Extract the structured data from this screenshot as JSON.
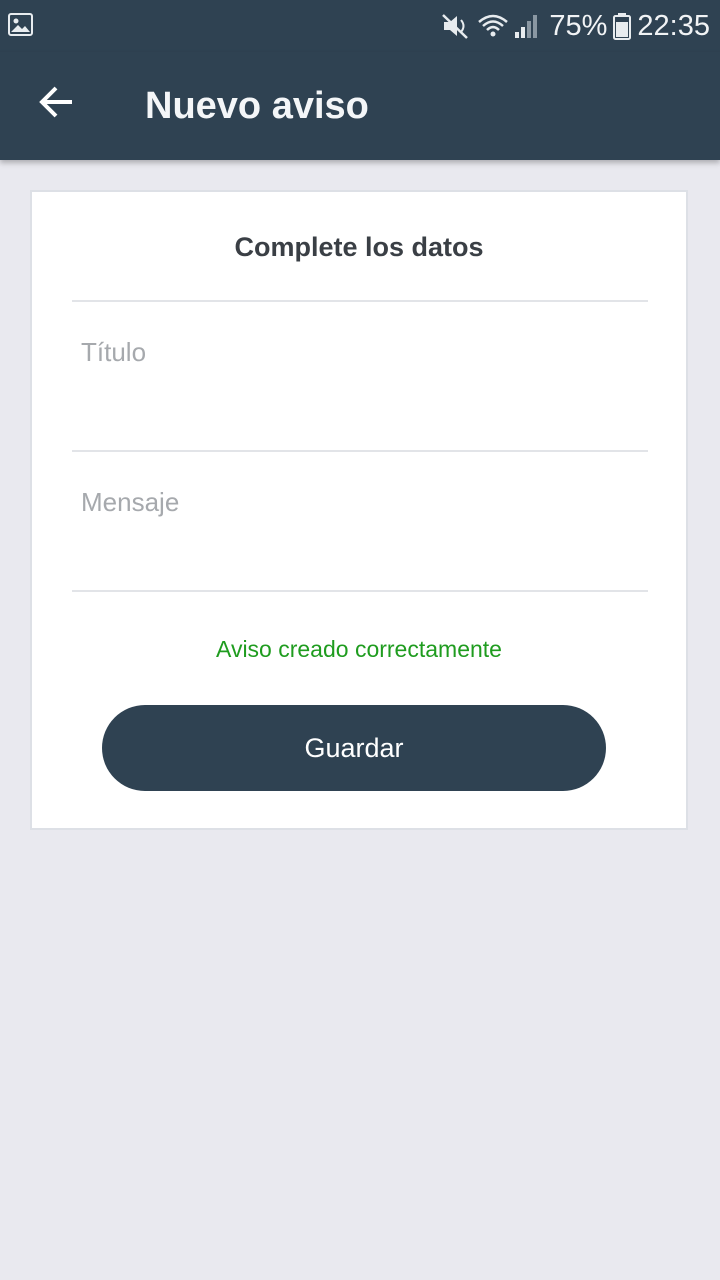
{
  "status_bar": {
    "battery_percent": "75%",
    "time": "22:35",
    "icons": [
      "image-icon",
      "mute-icon",
      "wifi-icon",
      "signal-icon",
      "battery-icon"
    ]
  },
  "app_bar": {
    "title": "Nuevo aviso",
    "back_icon": "arrow-back-icon"
  },
  "form": {
    "heading": "Complete los datos",
    "title_field": {
      "value": "",
      "placeholder": "Título"
    },
    "message_field": {
      "value": "",
      "placeholder": "Mensaje"
    },
    "status_message": "Aviso creado correctamente",
    "save_label": "Guardar"
  },
  "colors": {
    "primary": "#2f4252",
    "background": "#e9e9ef",
    "success": "#1f9c1f",
    "placeholder": "#a6a9ad"
  }
}
